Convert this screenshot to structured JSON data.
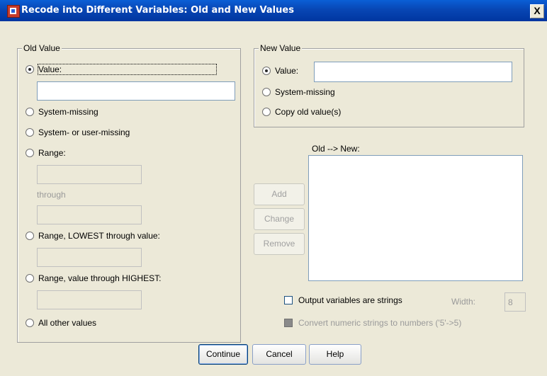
{
  "window": {
    "title": "Recode into Different Variables: Old and New Values",
    "close_glyph": "X"
  },
  "old_value": {
    "group_label": "Old Value",
    "value_label": "Value:",
    "value_text": "",
    "system_missing_label": "System-missing",
    "system_user_missing_label": "System- or user-missing",
    "range_label": "Range:",
    "range_from": "",
    "through_label": "through",
    "range_to": "",
    "range_lowest_label": "Range, LOWEST through value:",
    "range_lowest_value": "",
    "range_highest_label": "Range, value through HIGHEST:",
    "range_highest_value": "",
    "all_other_label": "All other values",
    "selected": "value"
  },
  "new_value": {
    "group_label": "New Value",
    "value_label": "Value:",
    "value_text": "",
    "system_missing_label": "System-missing",
    "copy_old_label": "Copy old value(s)",
    "selected": "value"
  },
  "mapping": {
    "list_label": "Old --> New:",
    "items": []
  },
  "mapping_buttons": {
    "add_label": "Add",
    "change_label": "Change",
    "remove_label": "Remove"
  },
  "options": {
    "output_strings_label": "Output variables are strings",
    "output_strings_checked": false,
    "width_label": "Width:",
    "width_value": "8",
    "convert_numeric_label": "Convert numeric strings to numbers ('5'->5)",
    "convert_numeric_checked": false
  },
  "footer": {
    "continue_label": "Continue",
    "cancel_label": "Cancel",
    "help_label": "Help"
  }
}
